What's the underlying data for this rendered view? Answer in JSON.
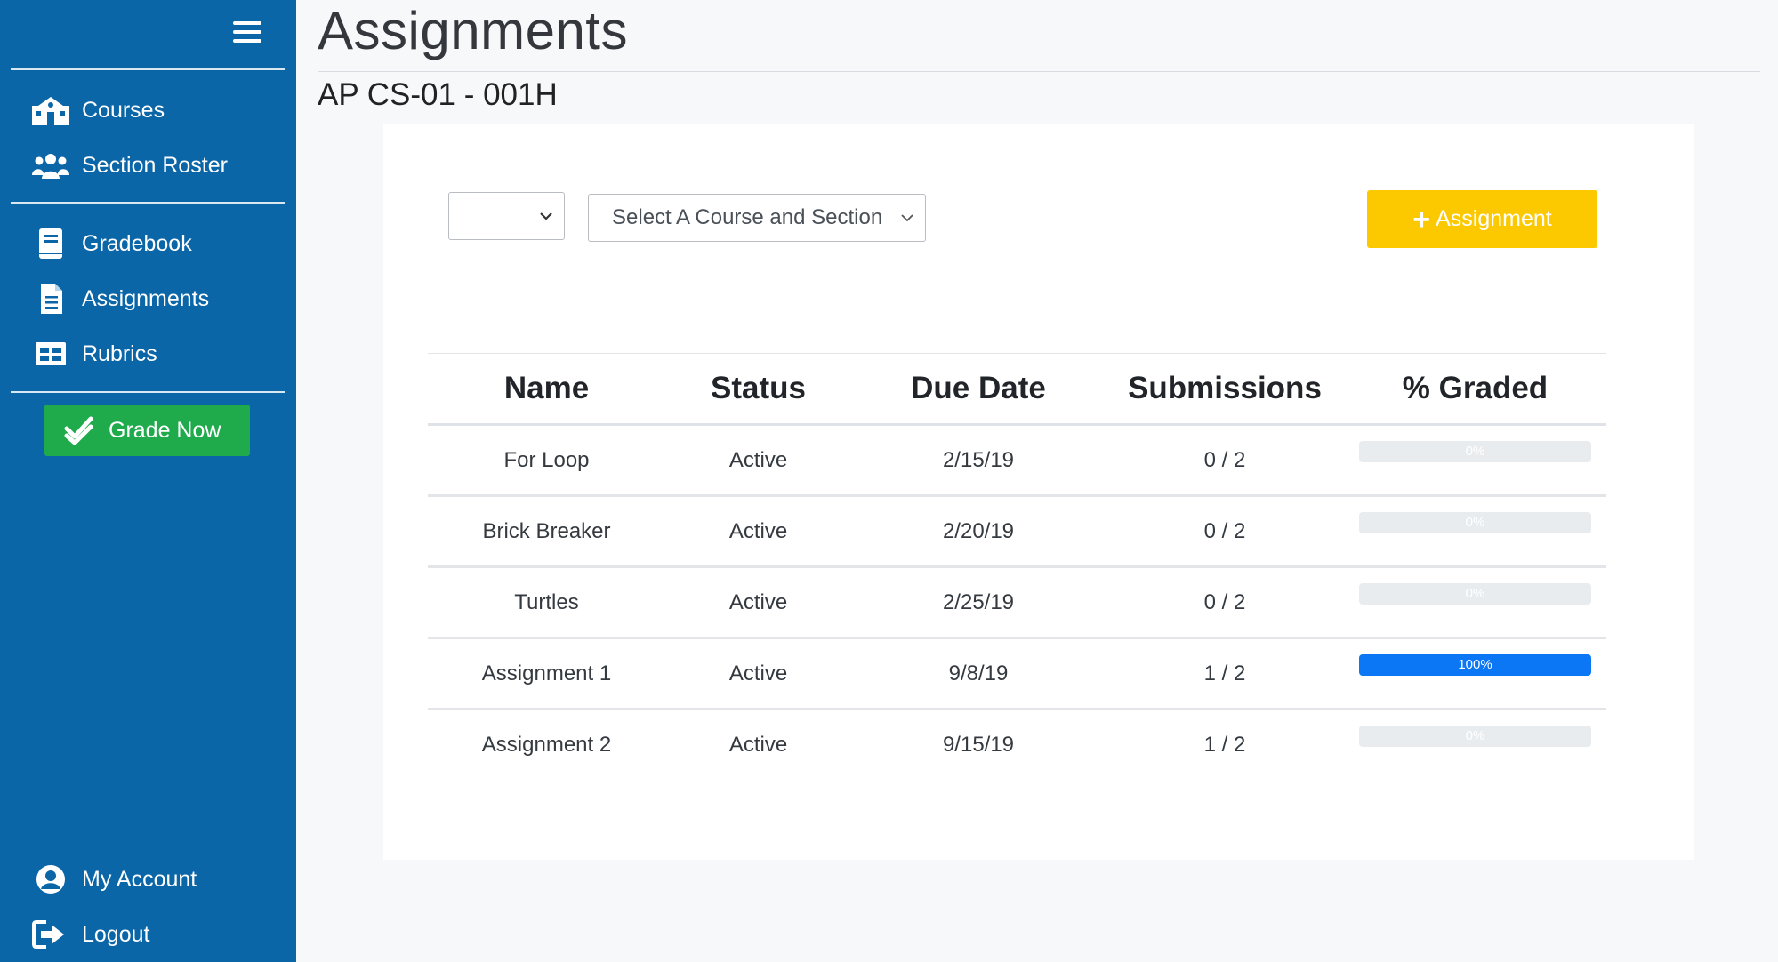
{
  "sidebar": {
    "items": [
      {
        "label": "Courses",
        "icon": "school-icon"
      },
      {
        "label": "Section Roster",
        "icon": "users-icon"
      },
      {
        "label": "Gradebook",
        "icon": "book-icon"
      },
      {
        "label": "Assignments",
        "icon": "file-text-icon"
      },
      {
        "label": "Rubrics",
        "icon": "table-icon"
      }
    ],
    "grade_now_label": "Grade Now",
    "account_label": "My Account",
    "logout_label": "Logout"
  },
  "header": {
    "title": "Assignments",
    "subtitle": "AP CS-01 - 001H"
  },
  "filters": {
    "small_select_value": "",
    "course_select_value": "Select A Course and Section"
  },
  "add_button_label": "Assignment",
  "table": {
    "columns": [
      "Name",
      "Status",
      "Due Date",
      "Submissions",
      "% Graded"
    ],
    "rows": [
      {
        "name": "For Loop",
        "status": "Active",
        "due": "2/15/19",
        "submissions": "0 / 2",
        "graded_text": "0%",
        "graded": 0
      },
      {
        "name": "Brick Breaker",
        "status": "Active",
        "due": "2/20/19",
        "submissions": "0 / 2",
        "graded_text": "0%",
        "graded": 0
      },
      {
        "name": "Turtles",
        "status": "Active",
        "due": "2/25/19",
        "submissions": "0 / 2",
        "graded_text": "0%",
        "graded": 0
      },
      {
        "name": "Assignment 1",
        "status": "Active",
        "due": "9/8/19",
        "submissions": "1 / 2",
        "graded_text": "100%",
        "graded": 100
      },
      {
        "name": "Assignment 2",
        "status": "Active",
        "due": "9/15/19",
        "submissions": "1 / 2",
        "graded_text": "0%",
        "graded": 0
      }
    ]
  },
  "colors": {
    "sidebar": "#0b66a8",
    "grade_now": "#1faa4b",
    "add_button": "#fcc800",
    "progress_fill": "#0b77f5"
  }
}
